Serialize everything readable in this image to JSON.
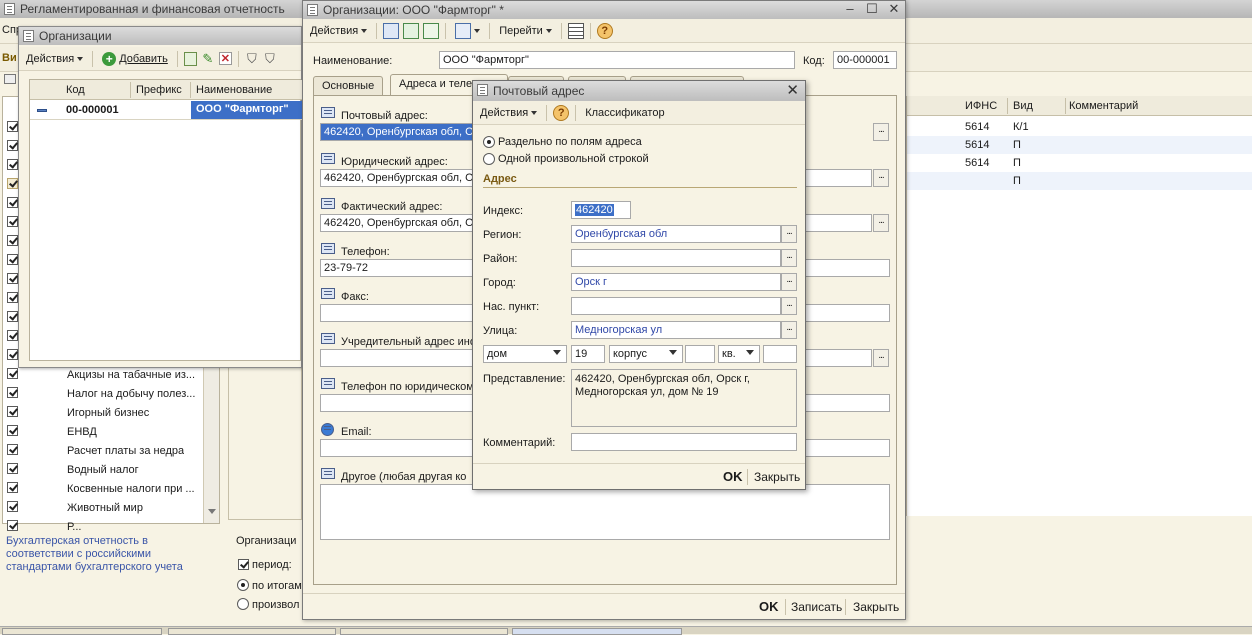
{
  "main_window": {
    "title": "Регламентированная и финансовая отчетность",
    "menu_text": "Спр",
    "toolbar_partial": "Ви",
    "right_table": {
      "headers": [
        "ИФНС",
        "Вид",
        "Комментарий"
      ],
      "rows": [
        {
          "ifns": "5614",
          "vid": "К/1"
        },
        {
          "ifns": "5614",
          "vid": "П"
        },
        {
          "ifns": "5614",
          "vid": "П"
        },
        {
          "ifns": "",
          "vid": "П"
        }
      ]
    },
    "left_list": [
      "Акцизы на табачные из...",
      "Налог на добычу полез...",
      "Игорный бизнес",
      "ЕНВД",
      "Расчет платы за недра",
      "Водный налог",
      "Косвенные налоги при ...",
      "Животный мир",
      "Р..."
    ],
    "bottom_link": "Бухгалтерская отчетность в соответствии с российскими стандартами бухгалтерского учета",
    "org_label": "Организаци",
    "period_label": "период:",
    "radio1": "по итогам",
    "radio2": "произвол"
  },
  "org_list_window": {
    "title": "Организации",
    "actions_label": "Действия",
    "add_label": "Добавить",
    "columns": [
      "Код",
      "Префикс",
      "Наименование"
    ],
    "rows": [
      {
        "code": "00-000001",
        "prefix": "",
        "name": "ООО \"Фармторг\""
      }
    ]
  },
  "org_form": {
    "title": "Организации: ООО \"Фармторг\" *",
    "actions_label": "Действия",
    "goto_label": "Перейти",
    "name_label": "Наименование:",
    "name_value": "ООО \"Фармторг\"",
    "code_label": "Код:",
    "code_value": "00-000001",
    "tabs": [
      "Основные",
      "Адреса и теле..."
    ],
    "sections": [
      {
        "label": "Почтовый адрес:",
        "value": "462420, Оренбургская обл, О"
      },
      {
        "label": "Юридический адрес:",
        "value": "462420, Оренбургская обл, О"
      },
      {
        "label": "Фактический адрес:",
        "value": "462420, Оренбургская обл, О"
      },
      {
        "label": "Телефон:",
        "value": "23-79-72"
      },
      {
        "label": "Факс:",
        "value": ""
      },
      {
        "label": "Учредительный адрес ино",
        "value": ""
      },
      {
        "label": "Телефон по юридическом",
        "value": ""
      },
      {
        "label": "Email:",
        "value": ""
      },
      {
        "label": "Другое (любая другая ко",
        "value": ""
      }
    ],
    "ok_label": "OK",
    "save_label": "Записать",
    "close_label": "Закрыть"
  },
  "postal_dialog": {
    "title": "Почтовый адрес",
    "actions_label": "Действия",
    "classifier_label": "Классификатор",
    "radio_fields": "Раздельно по полям адреса",
    "radio_line": "Одной произвольной строкой",
    "group_title": "Адрес",
    "index_label": "Индекс:",
    "index_value": "462420",
    "region_label": "Регион:",
    "region_value": "Оренбургская обл",
    "district_label": "Район:",
    "district_value": "",
    "city_label": "Город:",
    "city_value": "Орск г",
    "locality_label": "Нас. пункт:",
    "locality_value": "",
    "street_label": "Улица:",
    "street_value": "Медногорская ул",
    "house_type": "дом",
    "house_value": "19",
    "building_type": "корпус",
    "building_value": "",
    "flat_type": "кв.",
    "flat_value": "",
    "repr_label": "Представление:",
    "repr_line1": "462420, Оренбургская обл, Орск г,",
    "repr_line2": "Медногорская ул, дом № 19",
    "comment_label": "Комментарий:",
    "comment_value": "",
    "ok_label": "OK",
    "close_label": "Закрыть"
  }
}
